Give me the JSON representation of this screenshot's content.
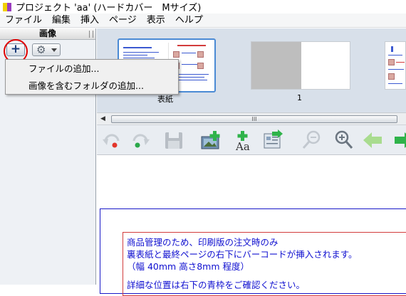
{
  "window": {
    "title": "プロジェクト 'aa' (ハードカバー　Mサイズ)"
  },
  "menu": {
    "items": [
      "ファイル",
      "編集",
      "挿入",
      "ページ",
      "表示",
      "ヘルプ"
    ]
  },
  "left_panel": {
    "header": "画像",
    "add_button_label": "+",
    "icons": {
      "add": "plus-icon",
      "settings": "gear-icon"
    }
  },
  "context_menu": {
    "items": [
      "ファイルの追加...",
      "画像を含むフォルダの追加..."
    ]
  },
  "pages": [
    {
      "label": "表紙",
      "selected": true
    },
    {
      "label": "1",
      "selected": false
    }
  ],
  "toolbar": {
    "icons": [
      "undo-icon",
      "redo-icon",
      "save-icon",
      "add-image-icon",
      "add-text-icon",
      "page-import-icon",
      "zoom-out-icon",
      "zoom-in-icon",
      "prev-page-icon",
      "next-page-icon"
    ]
  },
  "notice": {
    "lines": [
      "商品管理のため、印刷版の注文時のみ",
      "裏表紙と最終ページの右下にバーコードが挿入されます。",
      "（幅 40mm 高さ8mm 程度）",
      "",
      "詳細な位置は右下の青枠をご確認ください。"
    ]
  },
  "colors": {
    "notice_text": "#1010d0",
    "page_frame": "#1818c8",
    "textbox_border": "#d23c3c",
    "highlight_ring": "#e00000",
    "selected_thumb": "#4a8ad4"
  }
}
